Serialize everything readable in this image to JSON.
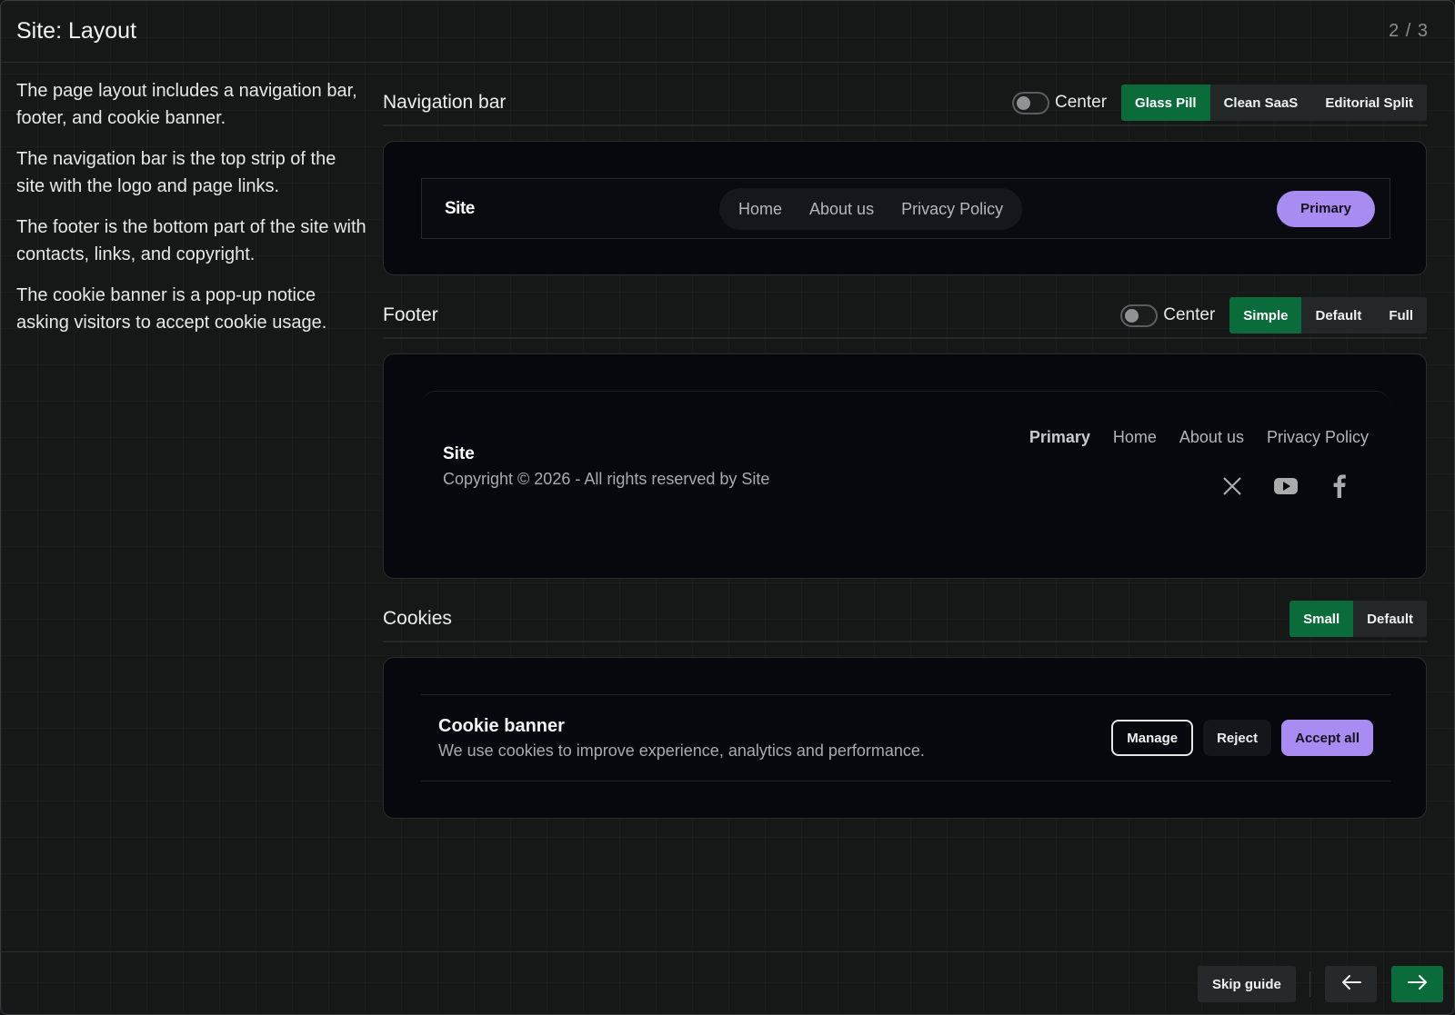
{
  "header": {
    "title": "Site: Layout",
    "counter": "2 / 3"
  },
  "description": [
    "The page layout includes a navigation bar, footer, and cookie banner.",
    "The navigation bar is the top strip of the site with the logo and page links.",
    "The footer is the bottom part of the site with contacts, links, and copyright.",
    "The cookie banner is a pop-up notice asking visitors to accept cookie usage."
  ],
  "navbar_section": {
    "label": "Navigation bar",
    "toggle_label": "Center",
    "options": [
      "Glass Pill",
      "Clean SaaS",
      "Editorial Split"
    ],
    "selected": "Glass Pill",
    "preview": {
      "brand": "Site",
      "links": [
        "Home",
        "About us",
        "Privacy Policy"
      ],
      "button": "Primary"
    }
  },
  "footer_section": {
    "label": "Footer",
    "toggle_label": "Center",
    "options": [
      "Simple",
      "Default",
      "Full"
    ],
    "selected": "Simple",
    "preview": {
      "brand": "Site",
      "copyright": "Copyright © 2026 - All rights reserved by Site",
      "links": [
        "Primary",
        "Home",
        "About us",
        "Privacy Policy"
      ],
      "social_icons": [
        "x-icon",
        "youtube-icon",
        "facebook-icon"
      ]
    }
  },
  "cookies_section": {
    "label": "Cookies",
    "options": [
      "Small",
      "Default"
    ],
    "selected": "Small",
    "preview": {
      "title": "Cookie banner",
      "text": "We use cookies to improve experience, analytics and performance.",
      "buttons": {
        "manage": "Manage",
        "reject": "Reject",
        "accept": "Accept all"
      }
    }
  },
  "bottom_bar": {
    "skip": "Skip guide",
    "prev_icon": "arrow-left-icon",
    "next_icon": "arrow-right-icon"
  },
  "colors": {
    "accent_green": "#0a6b3b",
    "accent_purple": "#a88cf2",
    "preview_bg": "#07080e"
  }
}
